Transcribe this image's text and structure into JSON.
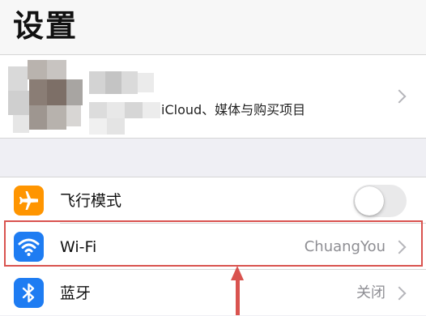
{
  "header": {
    "title": "设置"
  },
  "profile": {
    "subtitle": "iCloud、媒体与购买项目"
  },
  "settings": [
    {
      "label": "飞行模式",
      "icon": "airplane-icon",
      "icon_color": "#ff9500",
      "toggle_on": false
    },
    {
      "label": "Wi-Fi",
      "value": "ChuangYou",
      "icon": "wifi-icon",
      "icon_color": "#007aff"
    },
    {
      "label": "蓝牙",
      "value": "关闭",
      "icon": "bluetooth-icon",
      "icon_color": "#007aff"
    }
  ],
  "annotation": {
    "highlight_color": "#d9534f"
  }
}
